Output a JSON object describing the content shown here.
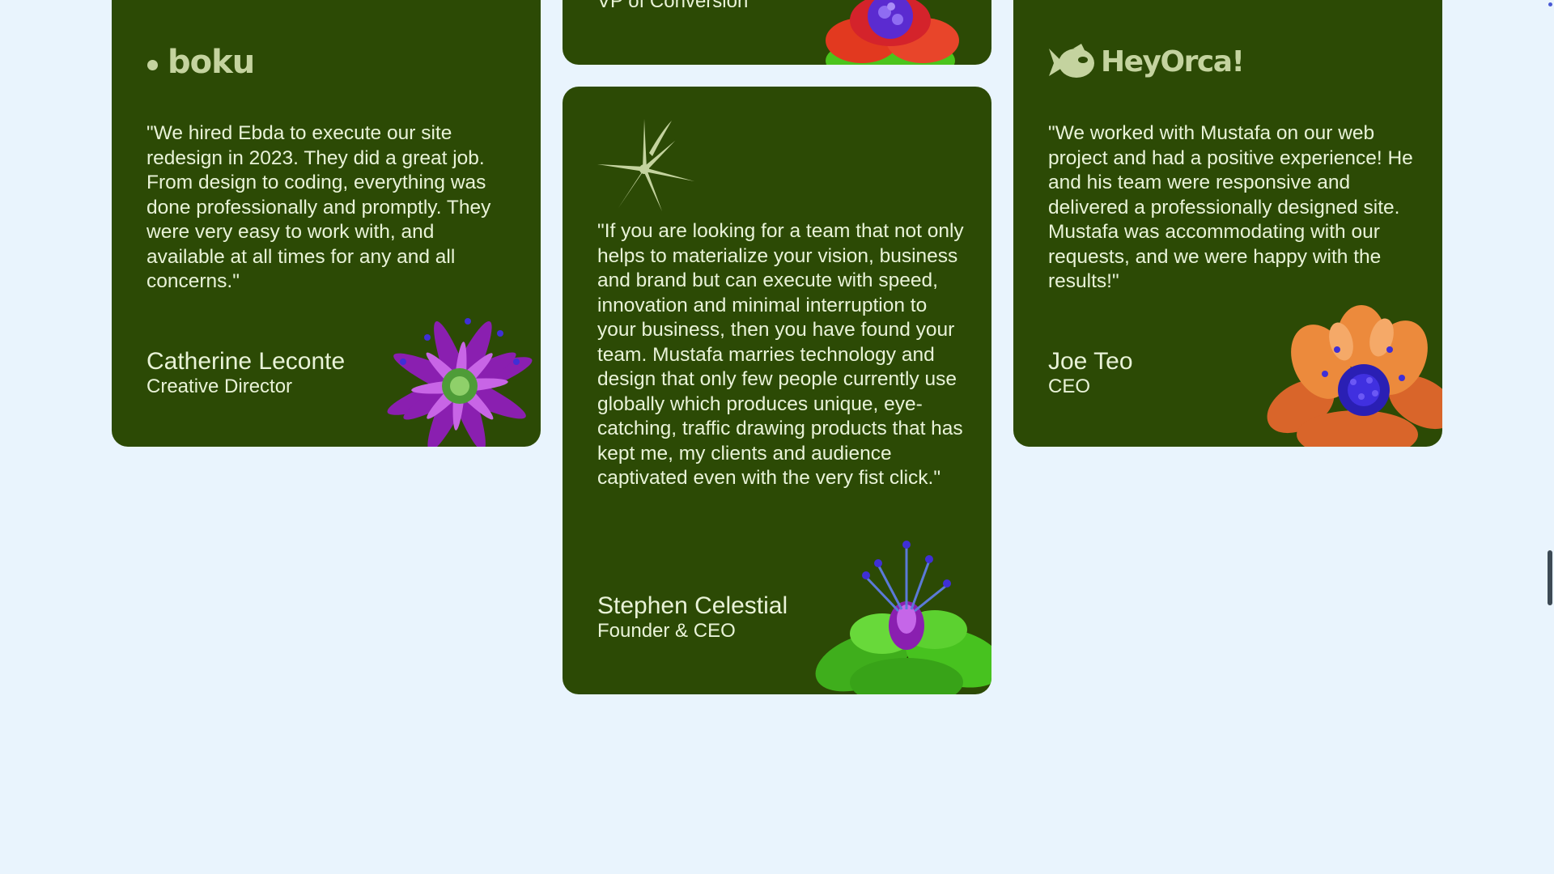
{
  "testimonials": {
    "top": {
      "role": "VP of Conversion"
    },
    "boku": {
      "logo": "boku",
      "quote": "\"We hired Ebda to execute our site redesign in 2023. They did a great job. From design to coding, everything was done professionally and promptly. They were very easy to work with, and available at all times for any and all concerns.\"",
      "name": "Catherine Leconte",
      "role": "Creative Director"
    },
    "stephen": {
      "logo_icon": "starburst-icon",
      "quote": "\"If you are looking for a team that not only helps to materialize your vision, business and brand but can execute with speed, innovation and minimal interruption to your business, then you have found your team. Mustafa marries technology and design that only few people currently use globally which produces unique, eye-catching, traffic drawing products that has kept me, my clients and audience captivated even with the very fist click.\"",
      "name": "Stephen Celestial",
      "role": "Founder & CEO"
    },
    "heyorca": {
      "logo": "HeyOrca!",
      "quote": "\"We worked with Mustafa on our web project and had a positive experience! He and his team were responsive and delivered a professionally designed site. Mustafa was accommodating with our requests, and we were happy with the results!\"",
      "name": "Joe Teo",
      "role": "CEO"
    }
  },
  "colors": {
    "background": "#e9f4fd",
    "card": "#2c4a05",
    "text": "#e9f3d8",
    "logo": "#c4d39f"
  }
}
